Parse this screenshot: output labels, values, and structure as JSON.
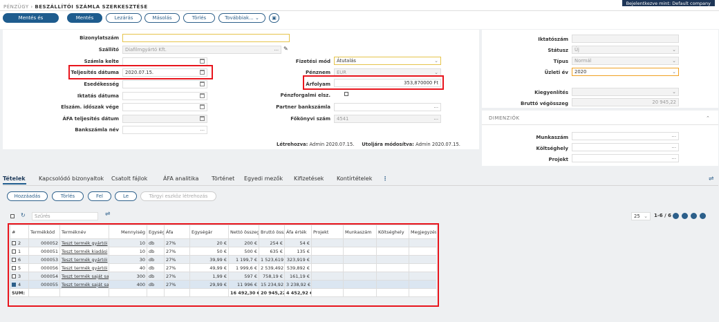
{
  "breadcrumb": {
    "module": "PÉNZÜGY",
    "title": "BESZÁLLÍTÓI SZÁMLA SZERKESZTÉSE"
  },
  "user_badge": "Bejelentkezve mint: Default company",
  "toolbar": {
    "save_close": "Mentés és bezárás",
    "save": "Mentés",
    "close": "Lezárás",
    "copy": "Másolás",
    "delete": "Törlés",
    "more": "Továbbiak..."
  },
  "form": {
    "bizonylatszam": {
      "label": "Bizonylatszám",
      "value": ""
    },
    "szallito": {
      "label": "Szállító",
      "value": "Diafilmgyártó Kft."
    },
    "szamla_kelte": {
      "label": "Számla kelte",
      "value": ""
    },
    "teljesites": {
      "label": "Teljesítés dátuma",
      "value": "2020.07.15."
    },
    "esedekesseg": {
      "label": "Esedékesség",
      "value": ""
    },
    "iktatas": {
      "label": "Iktatás dátuma",
      "value": ""
    },
    "elszam": {
      "label": "Elszám. időszak vége",
      "value": ""
    },
    "afa_telj": {
      "label": "ÁFA teljesítés dátum",
      "value": ""
    },
    "bankszamla": {
      "label": "Bankszámla név",
      "value": ""
    },
    "fizetesi": {
      "label": "Fizetési mód",
      "value": "Átutalás"
    },
    "penznem": {
      "label": "Pénznem",
      "value": "EUR"
    },
    "arfolyam": {
      "label": "Árfolyam",
      "value": "353,870000 Ft"
    },
    "penzforgalmi": {
      "label": "Pénzforgalmi elsz."
    },
    "partner_bank": {
      "label": "Partner bankszámla",
      "value": ""
    },
    "fokonyvi": {
      "label": "Főkönyvi szám",
      "value": "4541"
    },
    "letrehozva": {
      "label": "Létrehozva:",
      "value": "Admin 2020.07.15."
    },
    "modositva": {
      "label": "Utoljára módosítva:",
      "value": "Admin 2020.07.15."
    }
  },
  "right": {
    "iktatoszam": {
      "label": "Iktatószám",
      "value": ""
    },
    "statusz": {
      "label": "Státusz",
      "value": "Új"
    },
    "tipus": {
      "label": "Típus",
      "value": "Normál"
    },
    "uzleti_ev": {
      "label": "Üzleti év",
      "value": "2020"
    },
    "kiegyenlites": {
      "label": "Kiegyenlítés",
      "value": ""
    },
    "brutto_vegosszeg": {
      "label": "Bruttó végösszeg",
      "value": "20 945,22"
    },
    "dim_title": "DIMENZIÓK",
    "munkaszam": {
      "label": "Munkaszám",
      "value": ""
    },
    "koltseghely": {
      "label": "Költséghely",
      "value": ""
    },
    "projekt": {
      "label": "Projekt",
      "value": ""
    }
  },
  "tabs": [
    "Tételek",
    "Kapcsolódó bizonyaltok",
    "Csatolt fájlok",
    "ÁFA analitika",
    "Történet",
    "Egyedi mezők",
    "Kifizetések",
    "Kontírtételek"
  ],
  "grid_buttons": {
    "add": "Hozzáadás",
    "delete": "Törlés",
    "up": "Fel",
    "down": "Le",
    "asset": "Tárgyi eszköz létrehozás"
  },
  "filter_placeholder": "Szűrés",
  "pagination": {
    "page_size": "25",
    "range": "1-6 / 6"
  },
  "table": {
    "headers": [
      "#",
      "Termékkód",
      "Terméknév",
      "Mennyiség",
      "Egység",
      "Áfa",
      "Egységár",
      "Nettó összeg",
      "Bruttó összeg",
      "Áfa érték",
      "Projekt",
      "Munkaszám",
      "Költséghely",
      "Megjegyzés"
    ],
    "rows": [
      {
        "n": "2",
        "code": "000052",
        "name": "Teszt termék gyártói",
        "qty": "10",
        "unit": "db",
        "vat": "27%",
        "price": "20 €",
        "net": "200 €",
        "gross": "254 €",
        "vatv": "54 €",
        "checked": false
      },
      {
        "n": "1",
        "code": "000051",
        "name": "Teszt termék kiadási",
        "qty": "10",
        "unit": "db",
        "vat": "27%",
        "price": "50 €",
        "net": "500 €",
        "gross": "635 €",
        "vatv": "135 €",
        "checked": false
      },
      {
        "n": "6",
        "code": "000053",
        "name": "Teszt termék gyártói",
        "qty": "30",
        "unit": "db",
        "vat": "27%",
        "price": "39,99 €",
        "net": "1 199,7 €",
        "gross": "1 523,619",
        "vatv": "323,919 €",
        "checked": false
      },
      {
        "n": "5",
        "code": "000056",
        "name": "Teszt termék gyártói",
        "qty": "40",
        "unit": "db",
        "vat": "27%",
        "price": "49,99 €",
        "net": "1 999,6 €",
        "gross": "2 539,492",
        "vatv": "539,892 €",
        "checked": false
      },
      {
        "n": "3",
        "code": "000054",
        "name": "Teszt termék saját sa",
        "qty": "300",
        "unit": "db",
        "vat": "27%",
        "price": "1,99 €",
        "net": "597 €",
        "gross": "758,19 €",
        "vatv": "161,19 €",
        "checked": false
      },
      {
        "n": "4",
        "code": "000055",
        "name": "Teszt termék saját sa",
        "qty": "400",
        "unit": "db",
        "vat": "27%",
        "price": "29,99 €",
        "net": "11 996 €",
        "gross": "15 234,92",
        "vatv": "3 238,92 €",
        "checked": true
      }
    ],
    "sum": {
      "label": "SUM:",
      "net": "16 492,30 €",
      "gross": "20 945,22 €",
      "vatv": "4 452,92 €"
    }
  },
  "colors": {
    "primary": "#1e5c8e",
    "highlight": "#e8141c",
    "navy": "#1d3557"
  }
}
